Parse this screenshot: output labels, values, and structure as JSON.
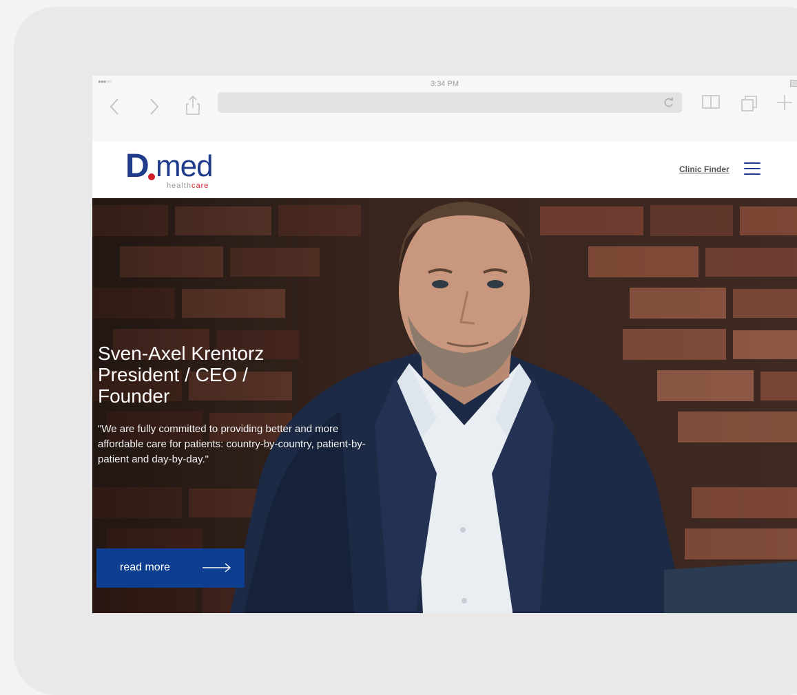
{
  "status_bar": {
    "signal": "●●●○○",
    "time": "3:34 PM"
  },
  "browser": {
    "back_icon": "chevron-left-icon",
    "forward_icon": "chevron-right-icon",
    "share_icon": "share-icon",
    "reload_icon": "reload-icon",
    "bookmarks_icon": "book-icon",
    "tabs_icon": "tabs-icon",
    "new_tab_icon": "plus-icon"
  },
  "header": {
    "logo_d": "D",
    "logo_med": "med",
    "logo_health": "health",
    "logo_care": "care",
    "clinic_finder": "Clinic Finder",
    "menu_icon": "hamburger-icon"
  },
  "hero": {
    "name": "Sven-Axel Krentorz",
    "role_line1": "President / CEO /",
    "role_line2": "Founder",
    "quote": "\"We are fully committed to providing better and more affordable care for patients: country-by-country, patient-by-patient and day-by-day.\"",
    "button_label": "read more"
  },
  "colors": {
    "brand_blue": "#1f3b8a",
    "brand_red": "#d2202b",
    "button_blue": "#0d3e8f"
  }
}
